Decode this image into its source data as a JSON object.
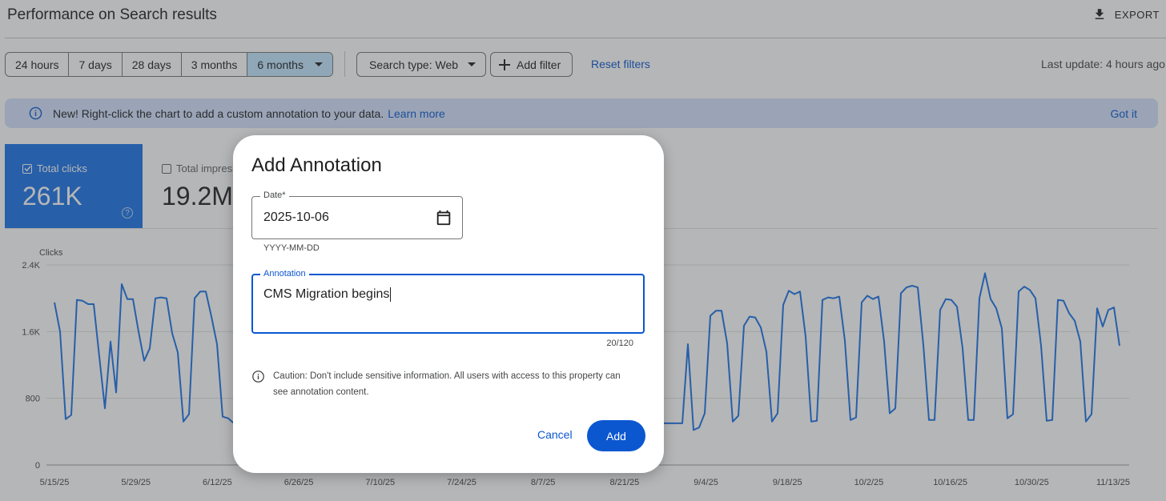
{
  "header": {
    "title": "Performance on Search results",
    "export_label": "EXPORT"
  },
  "filters": {
    "ranges": [
      "24 hours",
      "7 days",
      "28 days",
      "3 months",
      "6 months"
    ],
    "selected_range": "6 months",
    "search_type": "Search type: Web",
    "add_filter": "Add filter",
    "reset": "Reset filters",
    "last_update": "Last update: 4 hours ago"
  },
  "banner": {
    "text": "New! Right-click the chart to add a custom annotation to your data.",
    "learn_more": "Learn more",
    "got_it": "Got it"
  },
  "metrics": {
    "clicks_label": "Total clicks",
    "clicks_value": "261K",
    "impressions_label": "Total impressions",
    "impressions_value": "19.2M"
  },
  "chart_data": {
    "type": "line",
    "ylabel": "Clicks",
    "yticks": [
      "0",
      "800",
      "1.6K",
      "2.4K"
    ],
    "ylim": [
      0,
      2400
    ],
    "xticks": [
      "5/15/25",
      "5/29/25",
      "6/12/25",
      "6/26/25",
      "7/10/25",
      "7/24/25",
      "8/7/25",
      "8/21/25",
      "9/4/25",
      "9/18/25",
      "10/2/25",
      "10/16/25",
      "10/30/25",
      "11/13/25"
    ],
    "series": [
      {
        "values": [
          1950,
          1600,
          550,
          600,
          1980,
          1970,
          1930,
          1930,
          1300,
          680,
          1480,
          870,
          2170,
          1990,
          1990,
          1600,
          1250,
          1400,
          2000,
          2010,
          2000,
          1580,
          1350,
          520,
          610,
          2000,
          2080,
          2080,
          1780,
          1450,
          580,
          560,
          500,
          500,
          500,
          500,
          500,
          500,
          500,
          500,
          500,
          500,
          500,
          500,
          500,
          500,
          500,
          500,
          500,
          500,
          500,
          500,
          500,
          500,
          500,
          500,
          500,
          500,
          500,
          500,
          500,
          500,
          500,
          500,
          500,
          500,
          500,
          500,
          500,
          500,
          500,
          500,
          500,
          500,
          500,
          500,
          500,
          500,
          500,
          500,
          500,
          500,
          500,
          500,
          500,
          500,
          500,
          500,
          500,
          500,
          500,
          500,
          500,
          500,
          500,
          500,
          500,
          500,
          500,
          500,
          500,
          500,
          500,
          500,
          500,
          500,
          500,
          500,
          500,
          500,
          500,
          500,
          500,
          1450,
          420,
          450,
          620,
          1790,
          1850,
          1850,
          1460,
          520,
          590,
          1670,
          1780,
          1770,
          1650,
          1360,
          520,
          620,
          1920,
          2090,
          2050,
          2080,
          1540,
          520,
          530,
          1980,
          2010,
          2000,
          2020,
          1490,
          540,
          570,
          1950,
          2030,
          1990,
          2020,
          1480,
          620,
          680,
          2060,
          2130,
          2150,
          2130,
          1440,
          540,
          540,
          1860,
          1990,
          1980,
          1900,
          1400,
          540,
          540,
          2000,
          2300,
          1990,
          1880,
          1640,
          560,
          610,
          2080,
          2140,
          2100,
          2000,
          1430,
          530,
          540,
          1980,
          1970,
          1820,
          1730,
          1480,
          520,
          610,
          1880,
          1660,
          1860,
          1890,
          1430
        ]
      }
    ]
  },
  "dialog": {
    "title": "Add Annotation",
    "date_label": "Date*",
    "date_value": "2025-10-06",
    "date_hint": "YYYY-MM-DD",
    "annotation_label": "Annotation",
    "annotation_value": "CMS Migration begins",
    "counter": "20/120",
    "caution": "Caution: Don't include sensitive information. All users with access to this property can see annotation content.",
    "cancel": "Cancel",
    "add": "Add"
  }
}
